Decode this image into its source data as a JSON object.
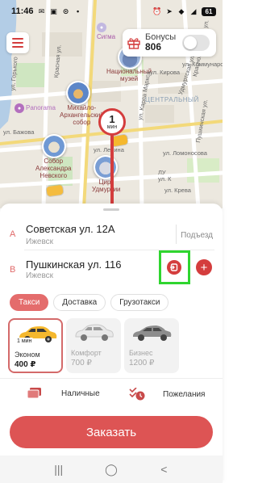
{
  "status_bar": {
    "time": "11:46",
    "battery": "61"
  },
  "map": {
    "labels": {
      "sigma": "Сигма",
      "museum": "Национальный\nмузей",
      "central": "ЦЕНТРАЛЬНЫЙ",
      "mikhailo": "Михайло-\nАрхангельский\nсобор",
      "alexander": "Собор\nАлександра\nНевского",
      "circus": "Цирк\nУдмуртии",
      "panorama": "Panorama",
      "lenina": "ул. Ленина",
      "kirova": "ул. Кирова",
      "udmurt": "Удмуртская ул.",
      "karla": "ул. Карла Маркса",
      "krasnaya": "Красная ул.",
      "kommunar": "ул. Коммунаров",
      "pushkin_st": "Пушкинская ул.",
      "krasnogeroy": "Красногеройская ул.",
      "gorkogo": "ул. Горького",
      "lomonosova": "ул. Ломоносова",
      "crossing": "ЛУ\nул. К",
      "bazhova": "ул. Бажова",
      "kreva": "ул. Крева"
    },
    "eta": {
      "value": "1",
      "unit": "мин"
    },
    "bonus": {
      "title": "Бонусы",
      "value": "806"
    }
  },
  "route": {
    "point_a": {
      "letter": "A",
      "address": "Советская ул. 12А",
      "city": "Ижевск",
      "action": "Подъезд"
    },
    "point_b": {
      "letter": "B",
      "address": "Пушкинская ул. 116",
      "city": "Ижевск",
      "add": "+"
    }
  },
  "service_tabs": [
    {
      "label": "Такси",
      "active": true
    },
    {
      "label": "Доставка",
      "active": false
    },
    {
      "label": "Грузотакси",
      "active": false
    }
  ],
  "tariffs": [
    {
      "eta": "1 мин",
      "name": "Эконом",
      "price": "400 ₽",
      "selected": true
    },
    {
      "name": "Комфорт",
      "price": "700 ₽",
      "selected": false
    },
    {
      "name": "Бизнес",
      "price": "1200 ₽",
      "selected": false
    }
  ],
  "payment": {
    "method": "Наличные",
    "wishes": "Пожелания"
  },
  "order_button": "Заказать",
  "colors": {
    "accent": "#dd5454",
    "highlight": "#2fd52f",
    "map_bg": "#ece8df"
  },
  "icons": {
    "menu": "hamburger-icon",
    "gift": "gift-icon",
    "route": "route-icon",
    "cash": "cash-icon",
    "wishes": "wishes-icon"
  }
}
